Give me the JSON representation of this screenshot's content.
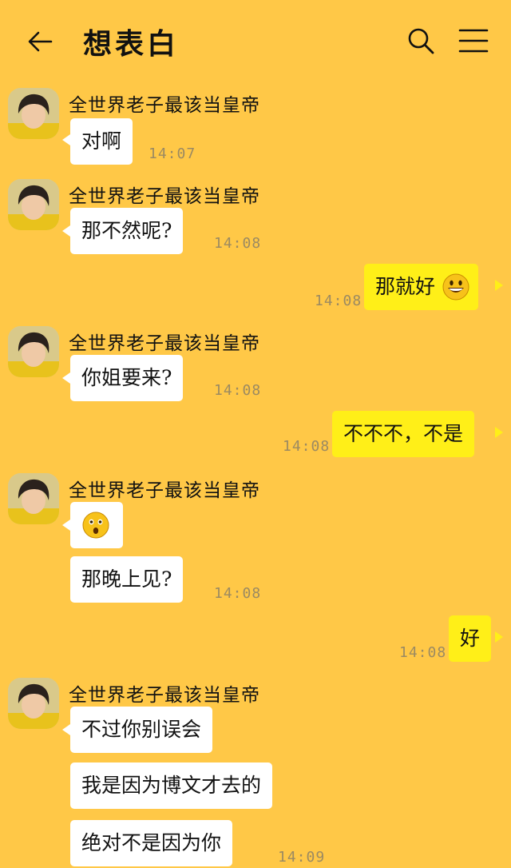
{
  "header": {
    "title": "想表白",
    "back_icon": "arrow-left-icon",
    "search_icon": "search-icon",
    "menu_icon": "hamburger-menu-icon"
  },
  "colors": {
    "background": "#FFC847",
    "incoming_bubble": "#FFFFFF",
    "outgoing_bubble": "#FFEF18"
  },
  "contact": {
    "name": "全世界老子最该当皇帝",
    "avatar_icon": "profile-photo"
  },
  "messages": [
    {
      "sender": "全世界老子最该当皇帝",
      "direction": "in",
      "text": "对啊",
      "time": "14:07"
    },
    {
      "sender": "全世界老子最该当皇帝",
      "direction": "in",
      "text": "那不然呢?",
      "time": "14:08"
    },
    {
      "direction": "out",
      "text": "那就好",
      "emoji": "grinning-face-emoji",
      "time": "14:08"
    },
    {
      "sender": "全世界老子最该当皇帝",
      "direction": "in",
      "text": "你姐要来?",
      "time": "14:08"
    },
    {
      "direction": "out",
      "text": "不不不，不是",
      "time": "14:08"
    },
    {
      "sender": "全世界老子最该当皇帝",
      "direction": "in",
      "text": "",
      "emoji": "astonished-face-emoji"
    },
    {
      "direction": "in",
      "text": "那晚上见?",
      "time": "14:08"
    },
    {
      "direction": "out",
      "text": "好",
      "time": "14:08"
    },
    {
      "sender": "全世界老子最该当皇帝",
      "direction": "in",
      "text": "不过你别误会"
    },
    {
      "direction": "in",
      "text": "我是因为博文才去的"
    },
    {
      "direction": "in",
      "text": "绝对不是因为你",
      "time": "14:09"
    }
  ]
}
